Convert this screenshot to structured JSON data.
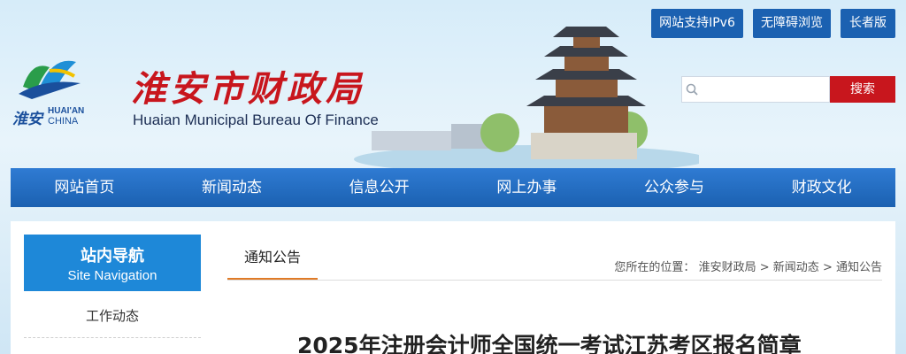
{
  "header": {
    "logo_cn": "淮安",
    "logo_en_line1": "HUAI'AN",
    "logo_en_line2": "CHINA",
    "title_cn": "淮安市财政局",
    "title_en": "Huaian Municipal Bureau Of Finance"
  },
  "top_buttons": [
    "网站支持IPv6",
    "无障碍浏览",
    "长者版"
  ],
  "search": {
    "placeholder": "",
    "button_label": "搜索"
  },
  "nav": [
    "网站首页",
    "新闻动态",
    "信息公开",
    "网上办事",
    "公众参与",
    "财政文化"
  ],
  "sidebar": {
    "heading_cn": "站内导航",
    "heading_en": "Site Navigation",
    "items": [
      "工作动态"
    ]
  },
  "main": {
    "tab_label": "通知公告",
    "breadcrumb": {
      "prefix": "您所在的位置：",
      "items": [
        "淮安财政局",
        "新闻动态",
        "通知公告"
      ],
      "separator": ">"
    },
    "article_title": "2025年注册会计师全国统一考试江苏考区报名简章"
  },
  "colors": {
    "nav_blue": "#1b61b1",
    "accent_red": "#c8161d",
    "side_blue": "#1e88d8",
    "tab_orange": "#e07b27"
  }
}
